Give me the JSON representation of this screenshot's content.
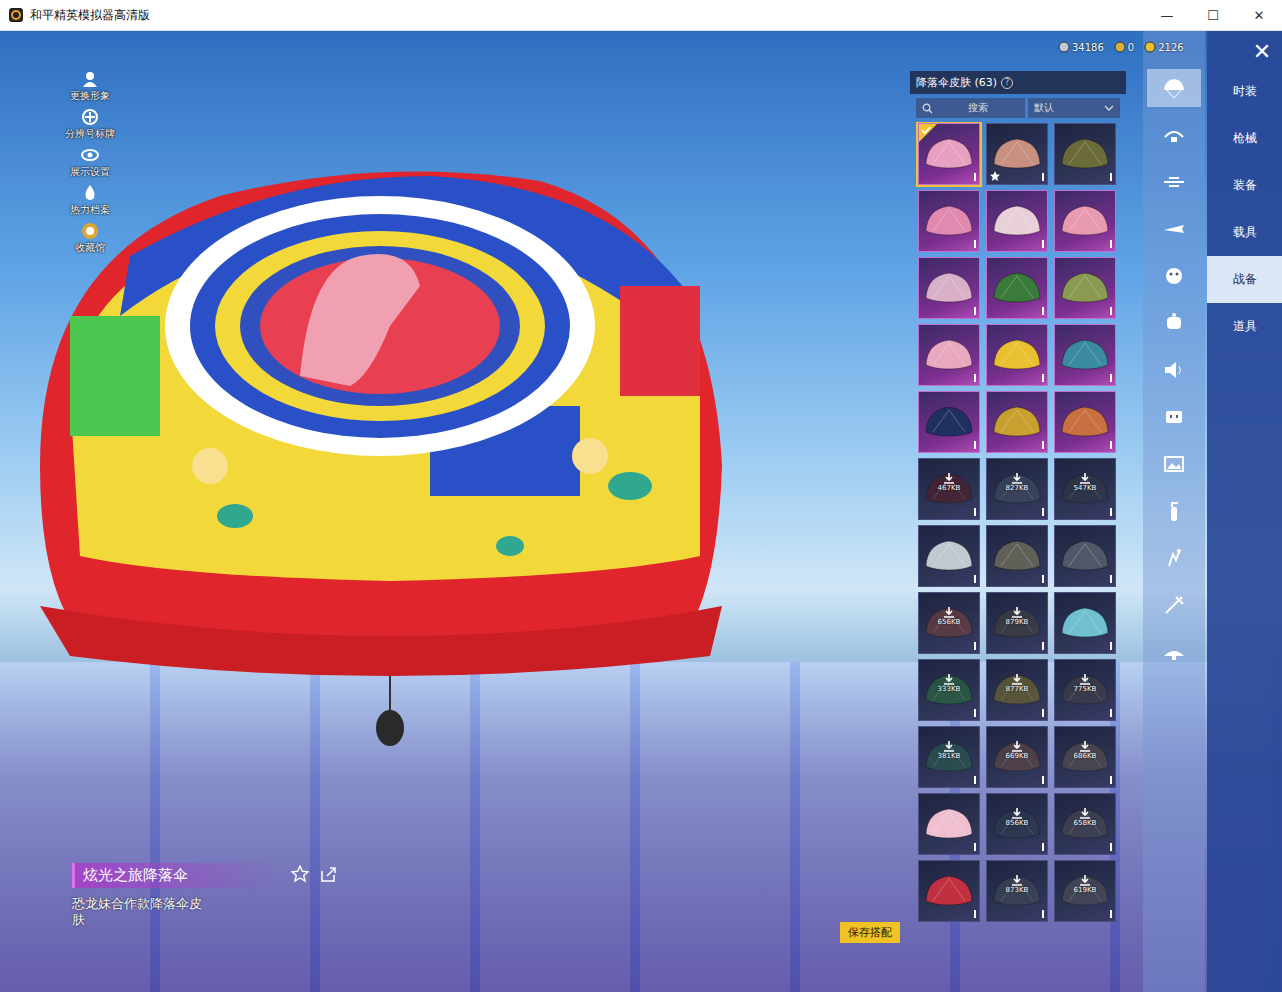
{
  "window": {
    "title": "和平精英模拟器高清版",
    "controls": [
      "—",
      "☐",
      "✕"
    ]
  },
  "currencies": [
    {
      "amount": "34186"
    },
    {
      "amount": "0"
    },
    {
      "amount": "2126"
    }
  ],
  "close": "✕",
  "side_menu": [
    {
      "label": "更换形象"
    },
    {
      "label": "分辨号标牌"
    },
    {
      "label": "展示设置"
    },
    {
      "label": "热力档案"
    },
    {
      "label": "收藏馆"
    }
  ],
  "panel": {
    "title": "降落伞皮肤 (63)",
    "help": "?",
    "search": "搜索",
    "sort": "默认"
  },
  "items": [
    {
      "kind": "epic",
      "color": "#e8a0c0",
      "selected": true,
      "favorite": false
    },
    {
      "kind": "rare",
      "color": "#c89080",
      "selected": false,
      "favorite": true
    },
    {
      "kind": "rare",
      "color": "#6b6b3a",
      "selected": false,
      "favorite": false
    },
    {
      "kind": "epic",
      "color": "#e08ab0",
      "selected": false,
      "favorite": false
    },
    {
      "kind": "epic",
      "color": "#e8d0d8",
      "selected": false,
      "favorite": false
    },
    {
      "kind": "epic",
      "color": "#e89ab0",
      "selected": false,
      "favorite": false
    },
    {
      "kind": "epic",
      "color": "#d8b0c8",
      "selected": false,
      "favorite": false
    },
    {
      "kind": "epic",
      "color": "#3a7a3a",
      "selected": false,
      "favorite": false
    },
    {
      "kind": "epic",
      "color": "#8a9a50",
      "selected": false,
      "favorite": false
    },
    {
      "kind": "epic",
      "color": "#e8a8c0",
      "selected": false,
      "favorite": false
    },
    {
      "kind": "epic",
      "color": "#e8c030",
      "selected": false,
      "favorite": false
    },
    {
      "kind": "epic",
      "color": "#3a8aa0",
      "selected": false,
      "favorite": false
    },
    {
      "kind": "epic",
      "color": "#203060",
      "selected": false,
      "favorite": false
    },
    {
      "kind": "epic",
      "color": "#c8a030",
      "selected": false,
      "favorite": false
    },
    {
      "kind": "epic",
      "color": "#c87040",
      "selected": false,
      "favorite": false
    },
    {
      "kind": "rare",
      "color": "#502028",
      "selected": false,
      "favorite": false,
      "size": "467KB"
    },
    {
      "kind": "rare",
      "color": "#404a60",
      "selected": false,
      "favorite": false,
      "size": "827KB"
    },
    {
      "kind": "rare",
      "color": "#303848",
      "selected": false,
      "favorite": false,
      "size": "547KB"
    },
    {
      "kind": "rare",
      "color": "#c0c8d0",
      "selected": false,
      "favorite": false
    },
    {
      "kind": "rare",
      "color": "#606058",
      "selected": false,
      "favorite": false
    },
    {
      "kind": "rare",
      "color": "#505868",
      "selected": false,
      "favorite": false
    },
    {
      "kind": "rare",
      "color": "#704040",
      "selected": false,
      "favorite": false,
      "size": "656KB"
    },
    {
      "kind": "rare",
      "color": "#404040",
      "selected": false,
      "favorite": false,
      "size": "879KB"
    },
    {
      "kind": "rare",
      "color": "#70c0d0",
      "selected": false,
      "favorite": false
    },
    {
      "kind": "rare",
      "color": "#2a6a40",
      "selected": false,
      "favorite": false,
      "size": "333KB"
    },
    {
      "kind": "rare",
      "color": "#706830",
      "selected": false,
      "favorite": false,
      "size": "877KB"
    },
    {
      "kind": "rare",
      "color": "#404048",
      "selected": false,
      "favorite": false,
      "size": "775KB"
    },
    {
      "kind": "rare",
      "color": "#2a5a50",
      "selected": false,
      "favorite": false,
      "size": "381KB"
    },
    {
      "kind": "rare",
      "color": "#604848",
      "selected": false,
      "favorite": false,
      "size": "669KB"
    },
    {
      "kind": "rare",
      "color": "#585050",
      "selected": false,
      "favorite": false,
      "size": "686KB"
    },
    {
      "kind": "rare",
      "color": "#f0c0d0",
      "selected": false,
      "favorite": false
    },
    {
      "kind": "rare",
      "color": "#303a50",
      "selected": false,
      "favorite": false,
      "size": "856KB"
    },
    {
      "kind": "rare",
      "color": "#484850",
      "selected": false,
      "favorite": false,
      "size": "658KB"
    },
    {
      "kind": "rare",
      "color": "#c03040",
      "selected": false,
      "favorite": false
    },
    {
      "kind": "rare",
      "color": "#404858",
      "selected": false,
      "favorite": false,
      "size": "873KB"
    },
    {
      "kind": "rare",
      "color": "#505058",
      "selected": false,
      "favorite": false,
      "size": "619KB"
    }
  ],
  "icon_tabs": [
    {
      "selected": true
    },
    {
      "selected": false
    },
    {
      "selected": false
    },
    {
      "selected": false
    },
    {
      "selected": false
    },
    {
      "selected": false
    },
    {
      "selected": false
    },
    {
      "selected": false
    },
    {
      "selected": false
    },
    {
      "selected": false
    },
    {
      "selected": false
    },
    {
      "selected": false
    },
    {
      "selected": false
    }
  ],
  "tabs": [
    {
      "label": "时装",
      "selected": false
    },
    {
      "label": "枪械",
      "selected": false
    },
    {
      "label": "装备",
      "selected": false
    },
    {
      "label": "载具",
      "selected": false
    },
    {
      "label": "战备",
      "selected": true
    },
    {
      "label": "道具",
      "selected": false
    }
  ],
  "preview": {
    "name": "炫光之旅降落伞",
    "description": "恐龙妹合作款降落伞皮肤"
  },
  "save_button": "保存搭配"
}
